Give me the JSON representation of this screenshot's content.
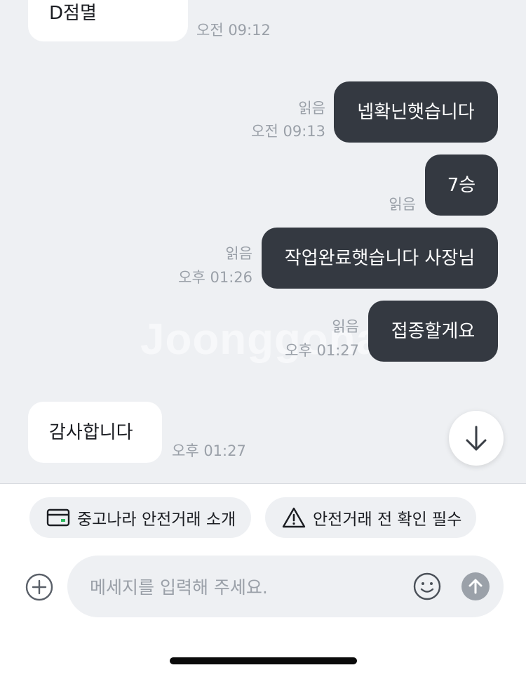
{
  "watermark": "Joonggonara",
  "messages": [
    {
      "text": "D점멸",
      "direction": "incoming",
      "time": "오전 09:12"
    },
    {
      "text": "넵확닌햇습니다",
      "direction": "outgoing",
      "read": "읽음",
      "time": "오전 09:13"
    },
    {
      "text": "7승",
      "direction": "outgoing",
      "read": "읽음",
      "time": ""
    },
    {
      "text": "작업완료햇습니다 사장님",
      "direction": "outgoing",
      "read": "읽음",
      "time": "오후 01:26"
    },
    {
      "text": "접종할게요",
      "direction": "outgoing",
      "read": "읽음",
      "time": "오후 01:27"
    },
    {
      "text": "감사합니다",
      "direction": "incoming",
      "time": "오후 01:27"
    }
  ],
  "chips": [
    {
      "label": "중고나라 안전거래 소개",
      "icon": "card-icon"
    },
    {
      "label": "안전거래 전 확인 필수",
      "icon": "warning-icon"
    }
  ],
  "composer": {
    "placeholder": "메세지를 입력해 주세요."
  },
  "colors": {
    "background": "#eef0f3",
    "outgoing_bubble": "#343941",
    "incoming_bubble": "#ffffff",
    "meta_text": "#9aa0a8",
    "card_accent": "#2bb85c"
  }
}
